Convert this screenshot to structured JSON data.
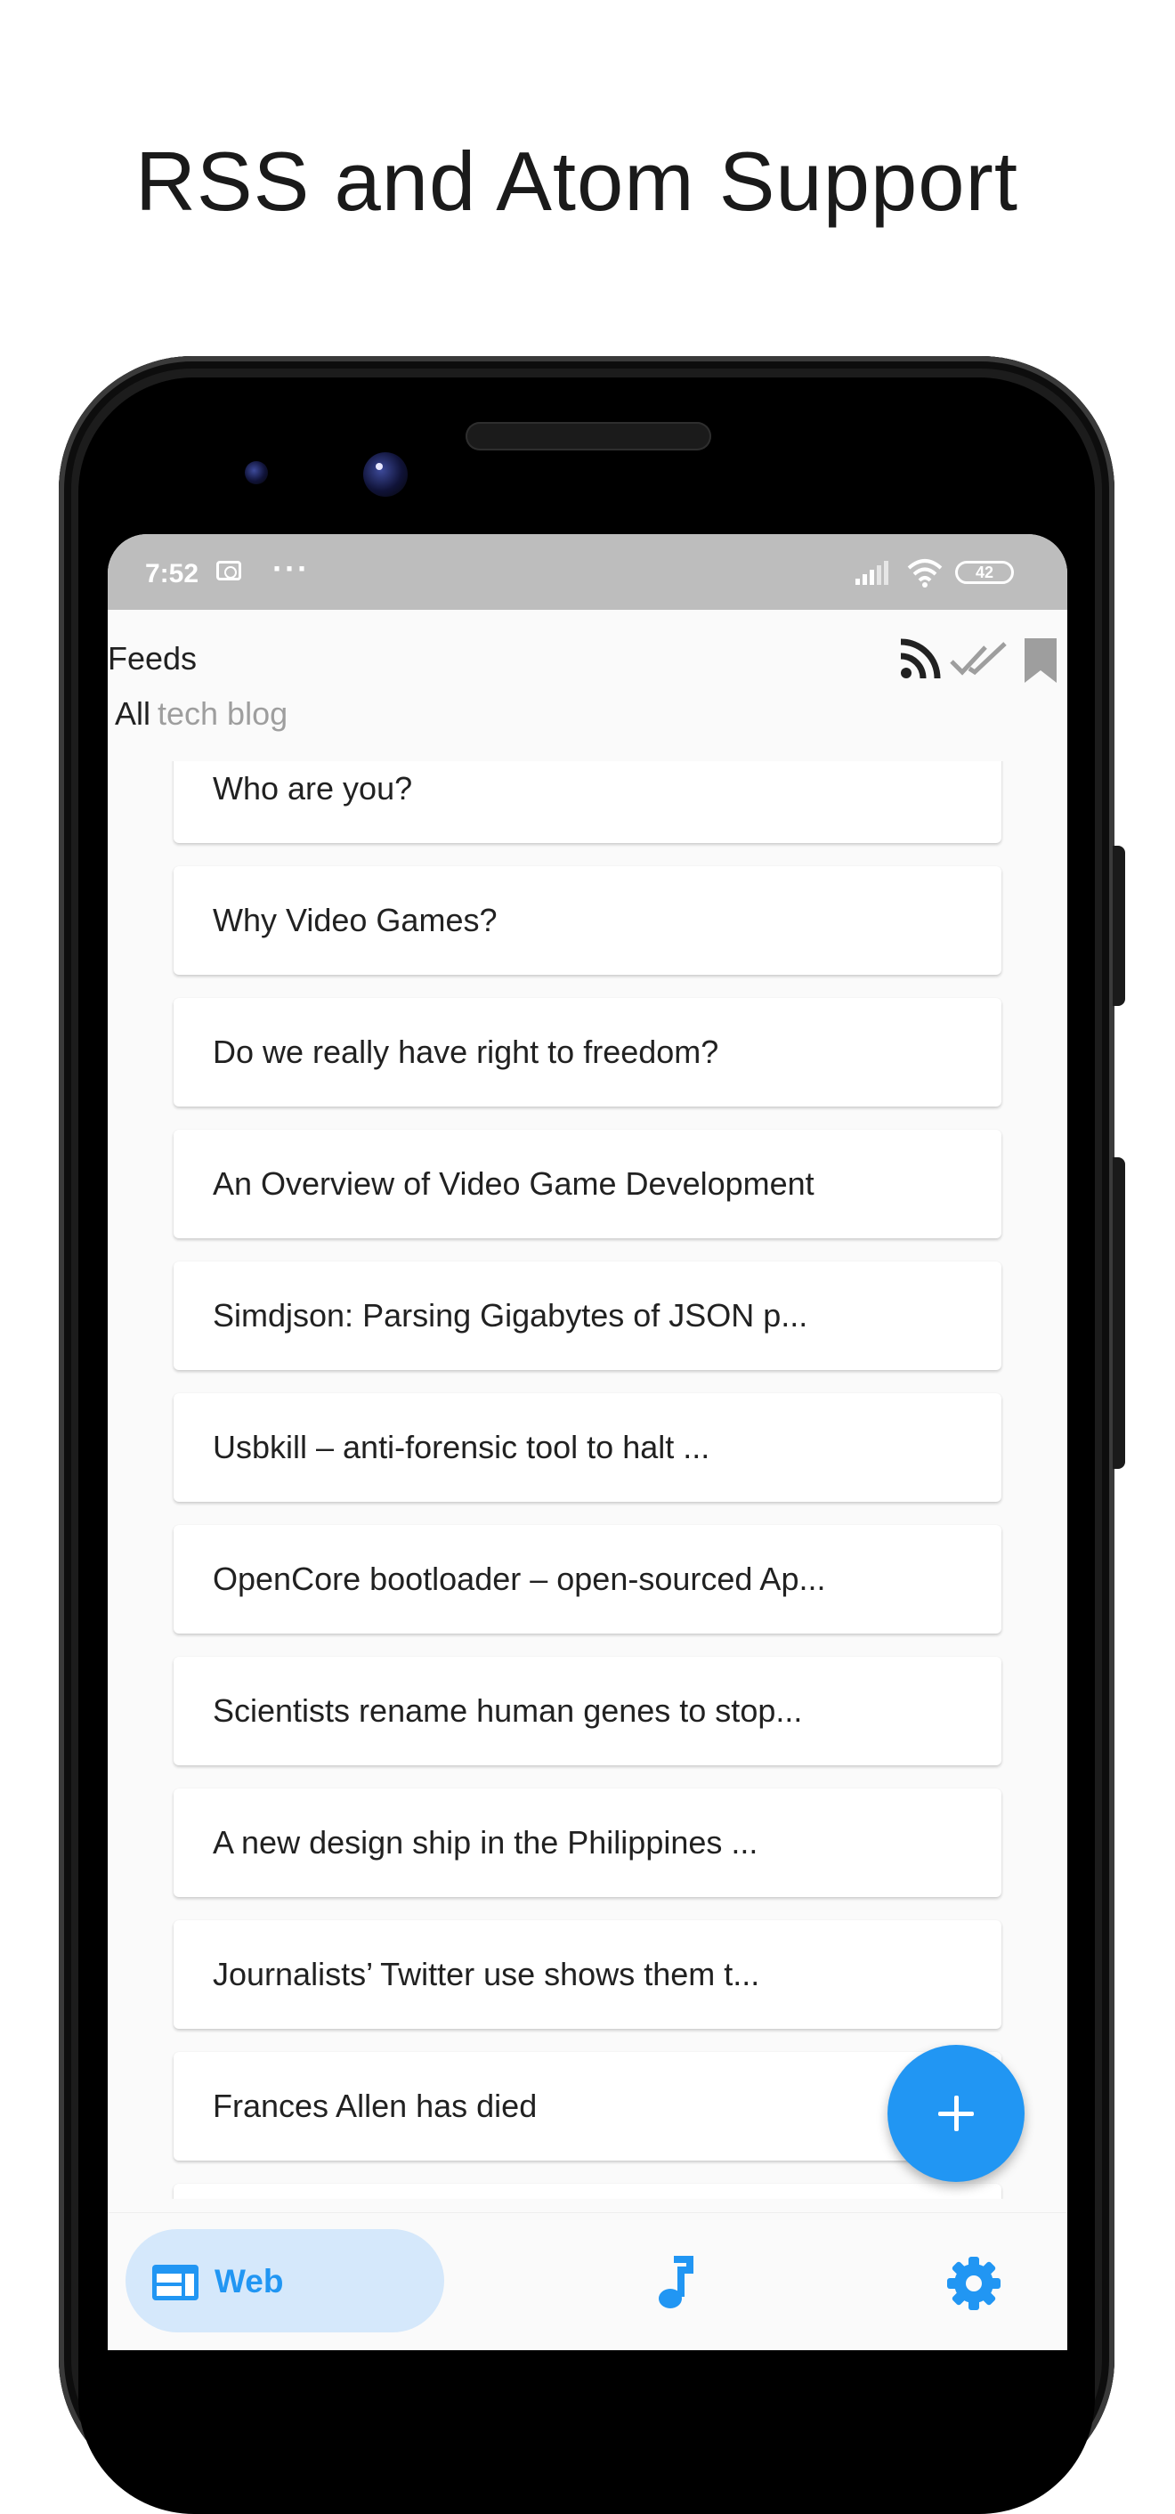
{
  "headline": "RSS and Atom Support",
  "status_bar": {
    "time": "7:52",
    "dots": "···",
    "battery": "42"
  },
  "app_bar": {
    "title": "Feeds",
    "tabs": [
      {
        "label": "All",
        "selected": true
      },
      {
        "label": "tech blog",
        "selected": false
      }
    ],
    "actions": [
      "rss-icon",
      "mark-all-read-icon",
      "bookmark-icon"
    ]
  },
  "feed_items": [
    {
      "title": "Who are you?"
    },
    {
      "title": "Why Video Games?"
    },
    {
      "title": "Do we really have right to freedom?"
    },
    {
      "title": "An Overview of Video Game Development"
    },
    {
      "title": "Simdjson: Parsing Gigabytes of JSON p..."
    },
    {
      "title": "Usbkill – anti-forensic tool to halt ..."
    },
    {
      "title": "OpenCore bootloader – open-sourced Ap..."
    },
    {
      "title": "Scientists rename human genes to stop..."
    },
    {
      "title": "A new design ship in the Philippines ..."
    },
    {
      "title": "Journalists’ Twitter use shows them t..."
    },
    {
      "title": "Frances Allen has died"
    }
  ],
  "fab": {
    "icon": "add-icon"
  },
  "bottom_nav": {
    "items": [
      {
        "label": "Web",
        "icon": "web-icon",
        "selected": true
      },
      {
        "label": "",
        "icon": "music-note-icon",
        "selected": false
      },
      {
        "label": "",
        "icon": "gear-icon",
        "selected": false
      }
    ]
  },
  "colors": {
    "accent": "#2196f3",
    "nav_selected_bg": "#d5e8fb",
    "status_bar": "#bdbdbd",
    "background": "#fafafa"
  }
}
